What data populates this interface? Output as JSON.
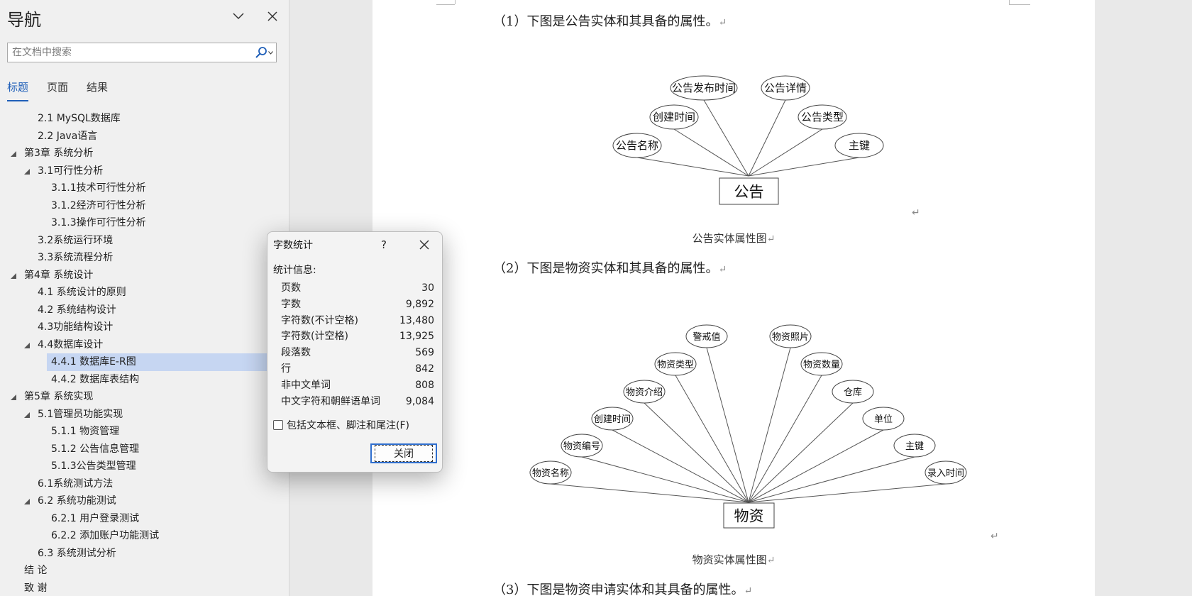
{
  "nav": {
    "title": "导航",
    "search_placeholder": "在文档中搜索",
    "tabs": [
      {
        "label": "标题",
        "active": true
      },
      {
        "label": "页面",
        "active": false
      },
      {
        "label": "结果",
        "active": false
      }
    ],
    "items": [
      {
        "label": "2.1 MySQL数据库",
        "level": 2,
        "caret": false
      },
      {
        "label": "2.2 Java语言",
        "level": 2,
        "caret": false
      },
      {
        "label": "第3章 系统分析",
        "level": 1,
        "caret": true
      },
      {
        "label": "3.1可行性分析",
        "level": 2,
        "caret": true
      },
      {
        "label": "3.1.1技术可行性分析",
        "level": 3,
        "caret": false
      },
      {
        "label": "3.1.2经济可行性分析",
        "level": 3,
        "caret": false
      },
      {
        "label": "3.1.3操作可行性分析",
        "level": 3,
        "caret": false
      },
      {
        "label": "3.2系统运行环境",
        "level": 2,
        "caret": false
      },
      {
        "label": "3.3系统流程分析",
        "level": 2,
        "caret": false
      },
      {
        "label": "第4章 系统设计",
        "level": 1,
        "caret": true
      },
      {
        "label": "4.1 系统设计的原则",
        "level": 2,
        "caret": false
      },
      {
        "label": "4.2 系统结构设计",
        "level": 2,
        "caret": false
      },
      {
        "label": "4.3功能结构设计",
        "level": 2,
        "caret": false
      },
      {
        "label": "4.4数据库设计",
        "level": 2,
        "caret": true
      },
      {
        "label": "4.4.1 数据库E-R图",
        "level": 3,
        "caret": false,
        "selected": true
      },
      {
        "label": "4.4.2 数据库表结构",
        "level": 3,
        "caret": false
      },
      {
        "label": "第5章 系统实现",
        "level": 1,
        "caret": true
      },
      {
        "label": "5.1管理员功能实现",
        "level": 2,
        "caret": true
      },
      {
        "label": "5.1.1 物资管理",
        "level": 3,
        "caret": false
      },
      {
        "label": "5.1.2 公告信息管理",
        "level": 3,
        "caret": false
      },
      {
        "label": "5.1.3公告类型管理",
        "level": 3,
        "caret": false
      },
      {
        "label": "6.1系统测试方法",
        "level": 2,
        "caret": false
      },
      {
        "label": "6.2 系统功能测试",
        "level": 2,
        "caret": true
      },
      {
        "label": "6.2.1 用户登录测试",
        "level": 3,
        "caret": false
      },
      {
        "label": "6.2.2 添加账户功能测试",
        "level": 3,
        "caret": false
      },
      {
        "label": "6.3 系统测试分析",
        "level": 2,
        "caret": false
      },
      {
        "label": "结  论",
        "level": 1,
        "caret": false
      },
      {
        "label": "致  谢",
        "level": 1,
        "caret": false
      }
    ]
  },
  "doc": {
    "para1": "（1）下图是公告实体和其具备的属性。",
    "para2": "（2）下图是物资实体和其具备的属性。",
    "para3": "（3）下图是物资申请实体和其具备的属性。",
    "caption1": "公告实体属性图",
    "caption2": "物资实体属性图",
    "return_mark": "↵",
    "er1": {
      "entity": "公告",
      "attributes": [
        "公告名称",
        "创建时间",
        "公告发布时间",
        "公告详情",
        "公告类型",
        "主键"
      ]
    },
    "er2": {
      "entity": "物资",
      "attributes": [
        "物资名称",
        "物资编号",
        "创建时间",
        "物资介绍",
        "物资类型",
        "警戒值",
        "物资照片",
        "物资数量",
        "仓库",
        "单位",
        "主键",
        "录入时间"
      ]
    }
  },
  "dialog": {
    "title": "字数统计",
    "help": "?",
    "section": "统计信息:",
    "stats": [
      {
        "label": "页数",
        "value": "30"
      },
      {
        "label": "字数",
        "value": "9,892"
      },
      {
        "label": "字符数(不计空格)",
        "value": "13,480"
      },
      {
        "label": "字符数(计空格)",
        "value": "13,925"
      },
      {
        "label": "段落数",
        "value": "569"
      },
      {
        "label": "行",
        "value": "842"
      },
      {
        "label": "非中文单词",
        "value": "808"
      },
      {
        "label": "中文字符和朝鲜语单词",
        "value": "9,084"
      }
    ],
    "checkbox_label": "包括文本框、脚注和尾注(F)",
    "checkbox_checked": false,
    "close_label": "关闭"
  },
  "icons": {
    "nav_collapse": "chevron-down-icon",
    "nav_close": "close-icon",
    "search": "search-icon",
    "dialog_close": "close-icon"
  }
}
